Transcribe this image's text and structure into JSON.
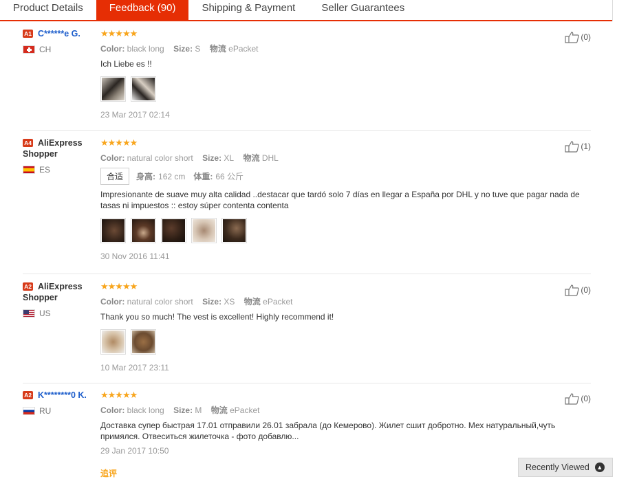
{
  "tabs": [
    {
      "label": "Product Details"
    },
    {
      "label": "Feedback (90)"
    },
    {
      "label": "Shipping & Payment"
    },
    {
      "label": "Seller Guarantees"
    }
  ],
  "reviews": [
    {
      "level": "A1",
      "name": "C******e G.",
      "country": "CH",
      "stars": "★★★★★",
      "color_label": "Color:",
      "color": "black long",
      "size_label": "Size:",
      "size": "S",
      "logistics_label": "物流",
      "logistics": "ePacket",
      "text": "Ich Liebe es !!",
      "date": "23 Mar 2017 02:14",
      "likes": "(0)"
    },
    {
      "level": "A4",
      "name": "AliExpress Shopper",
      "country": "ES",
      "stars": "★★★★★",
      "color_label": "Color:",
      "color": "natural color short",
      "size_label": "Size:",
      "size": "XL",
      "logistics_label": "物流",
      "logistics": "DHL",
      "fit_label": "合适",
      "height_label": "身高:",
      "height": "162 cm",
      "weight_label": "体重:",
      "weight": "66 公斤",
      "text": "Impresionante de suave muy alta calidad ..destacar que tardó solo 7 días en llegar a España por DHL y no tuve que pagar nada de tasas ni impuestos :: estoy súper contenta contenta",
      "date": "30 Nov 2016 11:41",
      "likes": "(1)"
    },
    {
      "level": "A2",
      "name": "AliExpress Shopper",
      "country": "US",
      "stars": "★★★★★",
      "color_label": "Color:",
      "color": "natural color short",
      "size_label": "Size:",
      "size": "XS",
      "logistics_label": "物流",
      "logistics": "ePacket",
      "text": "Thank you so much! The vest is excellent! Highly recommend it!",
      "date": "10 Mar 2017 23:11",
      "likes": "(0)"
    },
    {
      "level": "A2",
      "name": "K********0 K.",
      "country": "RU",
      "stars": "★★★★★",
      "color_label": "Color:",
      "color": "black long",
      "size_label": "Size:",
      "size": "M",
      "logistics_label": "物流",
      "logistics": "ePacket",
      "text": "Доставка супер быстрая 17.01 отправили 26.01 забрала (до Кемерово). Жилет сшит добротно. Мех натуральный,чуть примялся. Отвеситься жилеточка - фото добавлю...",
      "date": "29 Jan 2017 10:50",
      "likes": "(0)"
    }
  ],
  "more_label": "追评",
  "recently_viewed": "Recently Viewed",
  "colors": {
    "accent": "#e62e04",
    "stars": "#f8a51c",
    "link": "#1f5fcc"
  }
}
